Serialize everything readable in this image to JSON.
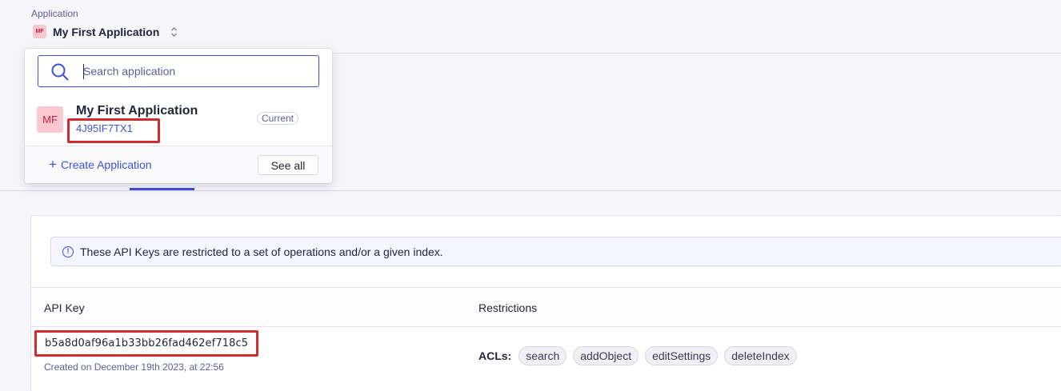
{
  "header": {
    "label": "Application",
    "selected_app_initials": "MF",
    "selected_app_name": "My First Application"
  },
  "dropdown": {
    "search_placeholder": "Search application",
    "search_value": "",
    "apps": [
      {
        "initials": "MF",
        "name": "My First Application",
        "id": "4J95IF7TX1",
        "badge": "Current"
      }
    ],
    "create_label": "Create Application",
    "see_all_label": "See all"
  },
  "notice": {
    "text": "These API Keys are restricted to a set of operations and/or a given index."
  },
  "table": {
    "columns": [
      "API Key",
      "Restrictions"
    ],
    "rows": [
      {
        "key": "b5a8d0af96a1b33bb26fad462ef718c5",
        "created": "Created on December 19th 2023, at 22:56",
        "acl_label": "ACLs:",
        "acls": [
          "search",
          "addObject",
          "editSettings",
          "deleteIndex"
        ]
      }
    ]
  },
  "colors": {
    "accent": "#3c4fe0",
    "highlight_border": "#d42c2c",
    "avatar_bg": "#fbc8d0",
    "avatar_fg": "#c2213c"
  }
}
